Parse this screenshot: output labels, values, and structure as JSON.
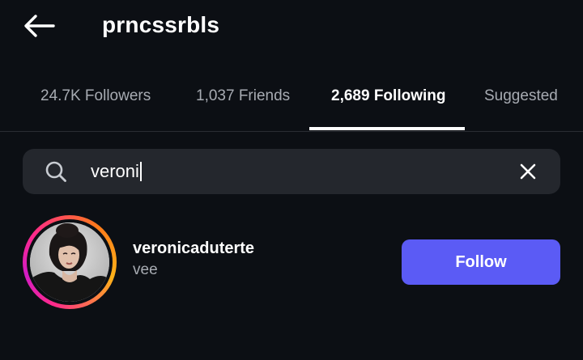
{
  "header": {
    "username": "prncssrbls",
    "back_icon": "arrow-left-icon"
  },
  "tabs": [
    {
      "label": "24.7K Followers",
      "active": false
    },
    {
      "label": "1,037 Friends",
      "active": false
    },
    {
      "label": "2,689 Following",
      "active": true
    },
    {
      "label": "Suggested",
      "active": false
    }
  ],
  "search": {
    "value": "veroni",
    "search_icon": "search-icon",
    "clear_icon": "close-icon"
  },
  "results": [
    {
      "username": "veronicaduterte",
      "nickname": "vee",
      "button_label": "Follow"
    }
  ],
  "colors": {
    "background": "#0c0f14",
    "search_bg": "#24272d",
    "follow_button": "#5b5bf5",
    "muted_text": "#a7abb2"
  }
}
